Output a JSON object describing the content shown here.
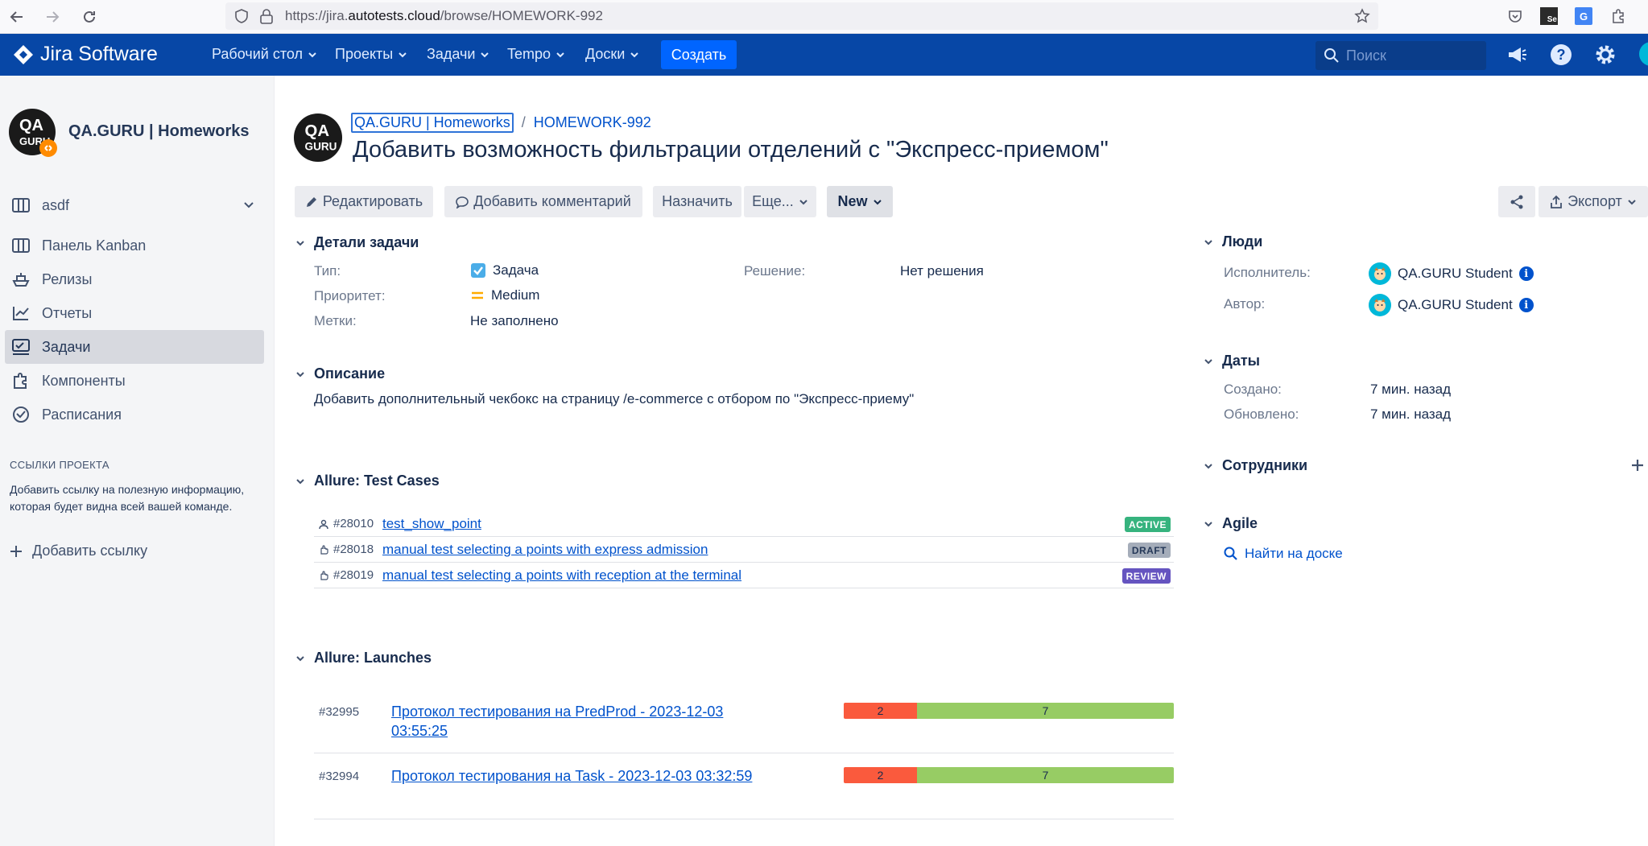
{
  "browser": {
    "url_prefix": "https://jira.",
    "url_domain": "autotests.cloud",
    "url_path": "/browse/HOMEWORK-992"
  },
  "topnav": {
    "logo": "Jira Software",
    "menus": [
      "Рабочий стол",
      "Проекты",
      "Задачи",
      "Tempo",
      "Доски"
    ],
    "create_label": "Создать",
    "search_placeholder": "Поиск"
  },
  "sidebar": {
    "project_name": "QA.GURU | Homeworks",
    "board_name": "asdf",
    "items": [
      "Панель Kanban",
      "Релизы",
      "Отчеты",
      "Задачи",
      "Компоненты",
      "Расписания"
    ],
    "active_item": "Задачи",
    "links_title": "ССЫЛКИ ПРОЕКТА",
    "links_help": "Добавить ссылку на полезную информацию, которая будет видна всей вашей команде.",
    "add_link": "Добавить ссылку"
  },
  "issue": {
    "project": "QA.GURU | Homeworks",
    "separator": "/",
    "key": "HOMEWORK-992",
    "title": "Добавить возможность фильтрации отделений с \"Экспресс-приемом\""
  },
  "toolbar": {
    "edit": "Редактировать",
    "comment": "Добавить комментарий",
    "assign": "Назначить",
    "more": "Еще...",
    "status": "New",
    "export": "Экспорт"
  },
  "details": {
    "heading": "Детали задачи",
    "type_label": "Тип:",
    "type_value": "Задача",
    "priority_label": "Приоритет:",
    "priority_value": "Medium",
    "labels_label": "Метки:",
    "labels_value": "Не заполнено",
    "resolution_label": "Решение:",
    "resolution_value": "Нет решения"
  },
  "description": {
    "heading": "Описание",
    "text": "Добавить дополнительный чекбокс на страницу /e-commerce с отбором по \"Экспресс-приему\""
  },
  "test_cases": {
    "heading": "Allure: Test Cases",
    "rows": [
      {
        "id": "#28010",
        "name": "test_show_point",
        "status": "ACTIVE",
        "color": "#36b37e",
        "kind": "automated"
      },
      {
        "id": "#28018",
        "name": "manual test selecting a points with express admission",
        "status": "DRAFT",
        "color": "#a5adba",
        "kind": "manual"
      },
      {
        "id": "#28019",
        "name": "manual test selecting a points with reception at the terminal",
        "status": "REVIEW",
        "color": "#6554c0",
        "kind": "manual"
      }
    ]
  },
  "launches": {
    "heading": "Allure: Launches",
    "rows": [
      {
        "id": "#32995",
        "name": "Протокол тестирования на PredProd - 2023-12-03 03:55:25",
        "failed": 2,
        "passed": 7
      },
      {
        "id": "#32994",
        "name": "Протокол тестирования на Task - 2023-12-03 03:32:59",
        "failed": 2,
        "passed": 7
      }
    ]
  },
  "people": {
    "heading": "Люди",
    "assignee_label": "Исполнитель:",
    "assignee": "QA.GURU Student",
    "reporter_label": "Автор:",
    "reporter": "QA.GURU Student"
  },
  "dates": {
    "heading": "Даты",
    "created_label": "Создано:",
    "created": "7 мин. назад",
    "updated_label": "Обновлено:",
    "updated": "7 мин. назад"
  },
  "staff": {
    "heading": "Сотрудники"
  },
  "agile": {
    "heading": "Agile",
    "find_on_board": "Найти на доске"
  }
}
